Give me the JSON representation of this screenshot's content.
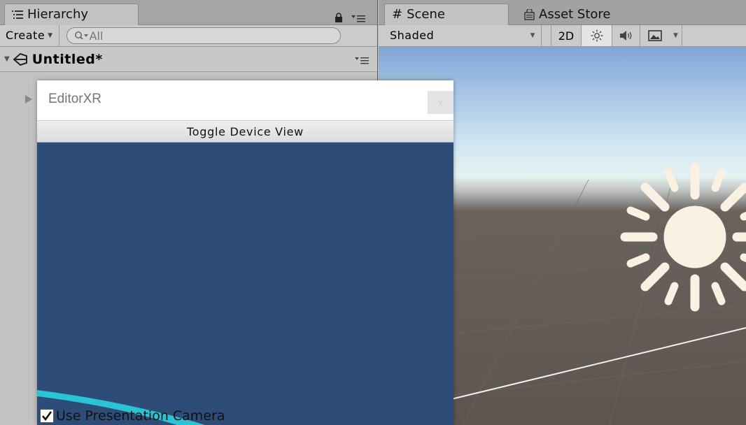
{
  "hierarchy": {
    "tab_label": "Hierarchy",
    "create_label": "Create",
    "search_placeholder": "All",
    "scene_name": "Untitled*"
  },
  "scene_panel": {
    "tab_scene": "Scene",
    "tab_asset_store": "Asset Store",
    "shading_mode": "Shaded",
    "btn_2d": "2D"
  },
  "editorxr": {
    "title": "EditorXR",
    "close_label": "x",
    "toggle_label": "Toggle Device View",
    "checkbox_label": "Use Presentation Camera",
    "checkbox_checked": true
  },
  "colors": {
    "panel_bg": "#c2c2c2",
    "editorxr_view_bg": "#2d4c78",
    "sun_color": "#fbf1e2"
  }
}
